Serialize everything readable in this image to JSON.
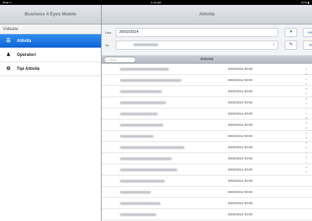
{
  "statusbar": {
    "carrier": "iPad ᯤ",
    "time": "4:20 AM",
    "battery": "57% ▮"
  },
  "master": {
    "title": "Business 4 Eyes Mobile",
    "section": "Videate",
    "items": [
      {
        "label": "Attività",
        "icon": "list-icon",
        "glyph": "☰"
      },
      {
        "label": "Operatori",
        "icon": "person-icon",
        "glyph": "♟"
      },
      {
        "label": "Tipi Attività",
        "icon": "gear-icon",
        "glyph": "⚙"
      }
    ]
  },
  "detail": {
    "title": "Attività",
    "filters": {
      "date_label": "Data",
      "date_value": "20/02/2014",
      "operator_label": "Op.",
      "operator_chevron": "›",
      "filter_glyph": "▼",
      "pin_glyph": "✎",
      "btn_top": "Mittente",
      "btn_bottom": "Ricevi"
    },
    "search_placeholder": "Cerca",
    "search_icon": "⌕",
    "list_title": "Attività",
    "row_icon": "›",
    "rows": [
      {
        "date": "20/02/2014 00:00",
        "name_w": 70
      },
      {
        "date": "20/02/2014 00:00",
        "name_w": 88
      },
      {
        "date": "20/02/2014 00:00",
        "name_w": 60
      },
      {
        "date": "20/02/2014 00:00",
        "name_w": 66
      },
      {
        "date": "20/02/2014 00:00",
        "name_w": 54
      },
      {
        "date": "20/02/2014 00:00",
        "name_w": 62
      },
      {
        "date": "20/02/2014 00:00",
        "name_w": 48
      },
      {
        "date": "20/02/2014 00:00",
        "name_w": 92
      },
      {
        "date": "20/02/2014 00:00",
        "name_w": 74
      },
      {
        "date": "20/02/2014 00:00",
        "name_w": 82
      },
      {
        "date": "20/02/2014 00:00",
        "name_w": 64
      },
      {
        "date": "20/02/2014 00:00",
        "name_w": 44
      },
      {
        "date": "20/02/2014 00:00",
        "name_w": 58
      },
      {
        "date": "20/02/2014 00:00",
        "name_w": 52
      }
    ],
    "index_letters": [
      "A",
      "B",
      "C",
      "D",
      "E",
      "F",
      "G",
      "H",
      "I",
      "L",
      "M",
      "N",
      "O",
      "P",
      "Q",
      "R",
      "S",
      "T",
      "U",
      "V",
      "Z",
      "#"
    ]
  }
}
